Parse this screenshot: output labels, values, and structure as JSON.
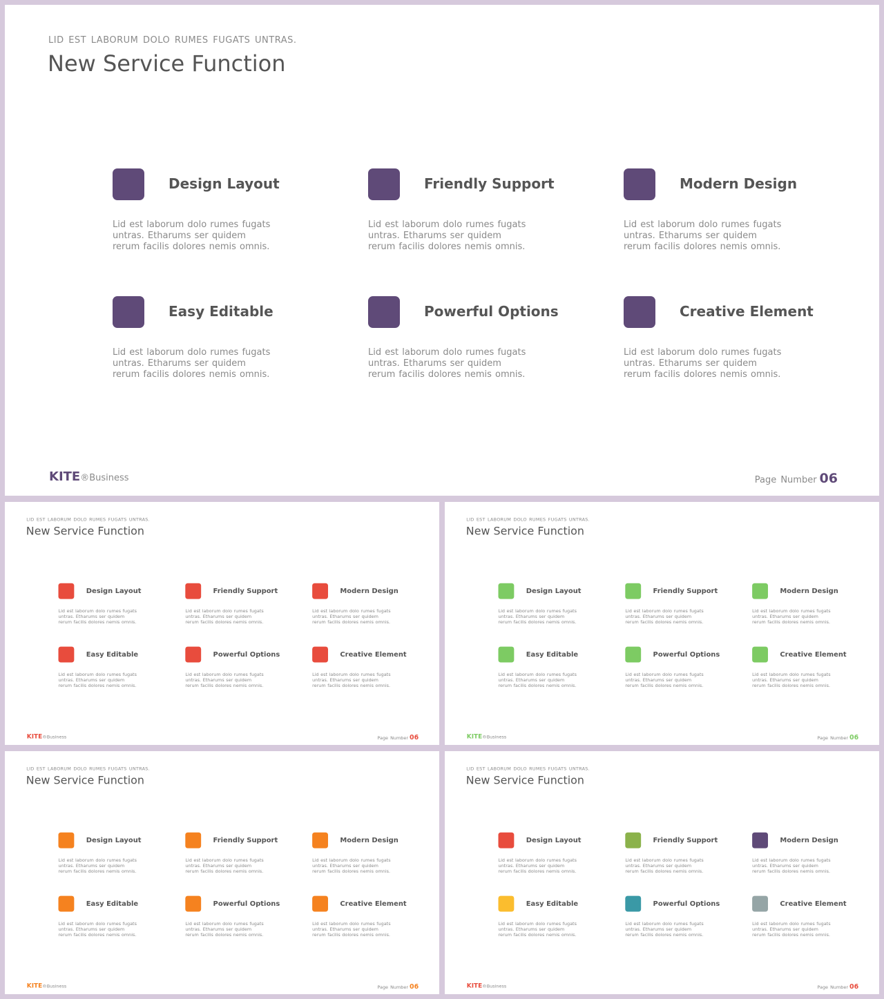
{
  "slide": {
    "subtitle": "LID EST LABORUM DOLO RUMES FUGATS UNTRAS.",
    "title": "New Service Function",
    "brand_name": "KITE",
    "brand_suffix": "®Business",
    "page_label": "Page Number",
    "page_number": "06"
  },
  "features": [
    {
      "name": "Design Layout",
      "desc": "Lid est laborum dolo rumes fugats untras. Etharums ser quidem rerum facilis dolores nemis omnis."
    },
    {
      "name": "Friendly Support",
      "desc": "Lid est laborum dolo rumes fugats untras. Etharums ser quidem rerum facilis dolores nemis omnis."
    },
    {
      "name": "Modern Design",
      "desc": "Lid est laborum dolo rumes fugats untras. Etharums ser quidem rerum facilis dolores nemis omnis."
    },
    {
      "name": "Easy Editable",
      "desc": "Lid est laborum dolo rumes fugats untras. Etharums ser quidem rerum facilis dolores nemis omnis."
    },
    {
      "name": "Powerful Options",
      "desc": "Lid est laborum dolo rumes fugats untras. Etharums ser quidem rerum facilis dolores nemis omnis."
    },
    {
      "name": "Creative Element",
      "desc": "Lid est laborum dolo rumes fugats untras. Etharums ser quidem rerum facilis dolores nemis omnis."
    }
  ],
  "variants": [
    {
      "id": "main",
      "accent": "#5f4a78",
      "tiles": [
        "#5f4a78",
        "#5f4a78",
        "#5f4a78",
        "#5f4a78",
        "#5f4a78",
        "#5f4a78"
      ]
    },
    {
      "id": "red",
      "accent": "#e84c3d",
      "tiles": [
        "#e84c3d",
        "#e84c3d",
        "#e84c3d",
        "#e84c3d",
        "#e84c3d",
        "#e84c3d"
      ]
    },
    {
      "id": "green",
      "accent": "#7dcb63",
      "tiles": [
        "#7dcb63",
        "#7dcb63",
        "#7dcb63",
        "#7dcb63",
        "#7dcb63",
        "#7dcb63"
      ]
    },
    {
      "id": "orange",
      "accent": "#f5821f",
      "tiles": [
        "#f5821f",
        "#f5821f",
        "#f5821f",
        "#f5821f",
        "#f5821f",
        "#f5821f"
      ]
    },
    {
      "id": "multi",
      "accent": "#e84c3d",
      "tiles": [
        "#e84c3d",
        "#8bb24b",
        "#5f4a78",
        "#fbbd2e",
        "#3a99a6",
        "#95a5a6"
      ]
    }
  ]
}
